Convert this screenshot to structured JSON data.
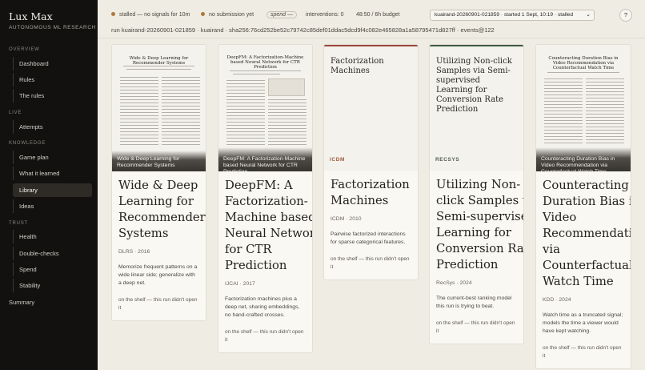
{
  "app": {
    "name": "Lux Max",
    "subtitle": "AUTONOMOUS ML RESEARCH"
  },
  "sidebar": {
    "sections": [
      {
        "label": "OVERVIEW",
        "items": [
          "Dashboard",
          "Rules",
          "The rules"
        ]
      },
      {
        "label": "LIVE",
        "items": [
          "Attempts"
        ]
      },
      {
        "label": "KNOWLEDGE",
        "items": [
          "Game plan",
          "What it learned",
          "Library",
          "Ideas"
        ]
      },
      {
        "label": "TRUST",
        "items": [
          "Health",
          "Double-checks",
          "Spend",
          "Stability"
        ]
      }
    ],
    "summary": "Summary",
    "active": "Library"
  },
  "header": {
    "status_stalled": "stalled — no signals for 10m",
    "status_submission": "no submission yet",
    "spend_label": "spend",
    "spend_suffix": "—",
    "interventions": "interventions: 0",
    "budget": "48:50 / 6h budget",
    "run_select": "kuairand-20260901-021859 · started 1 Sept, 10:19 · stalled",
    "help": "?",
    "run_line": "run kuairand-20260901-021859 · kuairand · sha256:76cd252be52c79742c85def01ddac5dcd9f4c082e465828a1a58795471d827ff · events@122",
    "chevron": "⌄"
  },
  "cards": [
    {
      "thumb_title": "Wide & Deep Learning for Recommender Systems",
      "overlay": "Wide & Deep Learning for Recommender Systems",
      "title": [
        "Wide & Deep",
        "Learning for",
        "Recommender",
        "Systems"
      ],
      "venue": "DLRS · 2016",
      "summary": "Memorize frequent patterns on a wide linear side; generalize with a deep net.",
      "shelf": "on the shelf — this run didn't open it"
    },
    {
      "thumb_title": "DeepFM: A Factorization-Machine based Neural Network for CTR Prediction",
      "overlay": "DeepFM: A Factorization-Machine based Neural Network for CTR Prediction",
      "title": [
        "DeepFM: A",
        "Factorization-",
        "Machine based",
        "Neural Network",
        "for CTR",
        "Prediction"
      ],
      "venue": "IJCAI · 2017",
      "summary": "Factorization machines plus a deep net, sharing embeddings, no hand-crafted crosses.",
      "shelf": "on the shelf — this run didn't open it"
    },
    {
      "big_title": "Factorization Machines",
      "venue_tag": "ICDM",
      "title": [
        "Factorization",
        "Machines"
      ],
      "venue": "ICDM · 2010",
      "summary": "Pairwise factorized interactions for sparse categorical features.",
      "shelf": "on the shelf — this run didn't open it"
    },
    {
      "big_title": "Utilizing Non-click Samples via Semi-supervised Learning for Conversion Rate Prediction",
      "venue_tag": "RECSYS",
      "title": [
        "Utilizing Non-",
        "click Samples via",
        "Semi-supervised",
        "Learning for",
        "Conversion Rate",
        "Prediction"
      ],
      "venue": "RecSys · 2024",
      "summary": "The current-best ranking model this run is trying to beat.",
      "shelf": "on the shelf — this run didn't open it"
    },
    {
      "thumb_title": "Counteracting Duration Bias in Video Recommendation via Counterfactual Watch Time",
      "overlay": "Counteracting Duration Bias in Video Recommendation via Counterfactual Watch Time",
      "title": [
        "Counteracting",
        "Duration Bias in",
        "Video",
        "Recommendation",
        "via",
        "Counterfactual",
        "Watch Time"
      ],
      "venue": "KDD · 2024",
      "summary": "Watch time as a truncated signal; models the time a viewer would have kept watching.",
      "shelf": "on the shelf — this run didn't open it"
    }
  ],
  "colors": {
    "sidebar_bg": "#121110",
    "page_bg": "#efece4",
    "accent_dot": "#b07a3c",
    "icdm_tag": "#a05a40",
    "recsys_tag": "#4f5f52"
  }
}
